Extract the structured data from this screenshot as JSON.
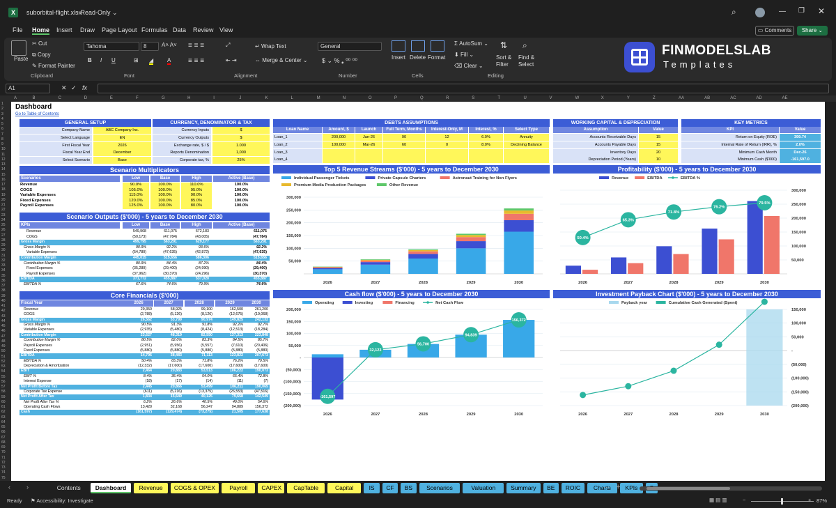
{
  "app": {
    "file_name": "suborbital-flight.xlsx",
    "mode": "Read-Only",
    "comments": "Comments",
    "share": "Share"
  },
  "menu": [
    "File",
    "Home",
    "Insert",
    "Draw",
    "Page Layout",
    "Formulas",
    "Data",
    "Review",
    "View"
  ],
  "ribbon": {
    "paste": "Paste",
    "cut": "Cut",
    "copy": "Copy",
    "format_painter": "Format Painter",
    "clipboard": "Clipboard",
    "font_name": "Tahoma",
    "font_size": "8",
    "font": "Font",
    "wrap": "Wrap Text",
    "merge": "Merge & Center",
    "alignment": "Alignment",
    "number_format": "General",
    "number": "Number",
    "insert": "Insert",
    "delete": "Delete",
    "format": "Format",
    "cells": "Cells",
    "autosum": "AutoSum",
    "fill": "Fill",
    "clear": "Clear",
    "sort": "Sort & Filter",
    "find": "Find & Select",
    "editing": "Editing",
    "brand": "FINMODELSLAB",
    "brand_sub": "Templates"
  },
  "formula_bar": {
    "cell_ref": "A1",
    "fx": "fx",
    "value": ""
  },
  "columns": [
    "A",
    "B",
    "C",
    "D",
    "E",
    "F",
    "G",
    "H",
    "I",
    "J",
    "K",
    "L",
    "M",
    "N",
    "O",
    "P",
    "Q",
    "R",
    "S",
    "T",
    "U",
    "V",
    "W",
    "X",
    "Y",
    "Z",
    "AA",
    "AB",
    "AC",
    "AD",
    "AE"
  ],
  "sheet": {
    "title": "Dashboard",
    "toc": "Go to Table of Contents",
    "general": {
      "title": "GENERAL SETUP",
      "rows": [
        [
          "Company Name",
          "ABC Company Inc."
        ],
        [
          "Select Language",
          "EN"
        ],
        [
          "First Fiscal Year",
          "2026"
        ],
        [
          "Fiscal Year End",
          "December"
        ],
        [
          "Select Scenario",
          "Base"
        ]
      ]
    },
    "currency": {
      "title": "CURRENCY, DENOMINATOR & TAX",
      "rows": [
        [
          "Currency Inputs",
          "$"
        ],
        [
          "Currency Outputs",
          "$"
        ],
        [
          "Exchange rate, $ / $",
          "1.000"
        ],
        [
          "Reports Denomination",
          "1,000"
        ],
        [
          "Corporate tax, %",
          "25%"
        ]
      ]
    },
    "debts": {
      "title": "DEBTS ASSUMPTIONS",
      "headers": [
        "Loan Name",
        "Amount, $",
        "Launch",
        "Full Term, Months",
        "Interest-Only, M",
        "Interest, %",
        "Select Type"
      ],
      "rows": [
        [
          "Loan_1",
          "200,000",
          "Jan-26",
          "90",
          "12",
          "6.0%",
          "Annuity"
        ],
        [
          "Loan_2",
          "100,000",
          "Mar-26",
          "60",
          "0",
          "8.0%",
          "Declining Balance"
        ],
        [
          "Loan_3",
          "",
          "",
          "",
          "",
          "",
          ""
        ],
        [
          "Loan_4",
          "",
          "",
          "",
          "",
          "",
          ""
        ]
      ]
    },
    "wc": {
      "title": "WORKING CAPITAL & DEPRECIATION",
      "headers": [
        "Assumption",
        "Value"
      ],
      "rows": [
        [
          "Accounts Receivable Days",
          "15"
        ],
        [
          "Accounts Payable Days",
          "15"
        ],
        [
          "Inventory Days",
          "20"
        ],
        [
          "Depreciation Period (Years)",
          "10"
        ]
      ]
    },
    "kpi": {
      "title": "KEY METRICS",
      "headers": [
        "KPI",
        "Value"
      ],
      "rows": [
        [
          "Return on Equity (ROE)",
          "399.74"
        ],
        [
          "Internal Rate of Return (IRR), %",
          "2.0%"
        ],
        [
          "Minimum Cash Month",
          "Dec-26"
        ],
        [
          "Minimum Cash ($'000)",
          "-161,597.0"
        ]
      ]
    },
    "multipliers": {
      "title": "Scenario Multiplicators",
      "headers": [
        "Scenarios",
        "Low",
        "Base",
        "High",
        "Active (Base)"
      ],
      "rows": [
        [
          "Revenue",
          "90.0%",
          "100.0%",
          "110.0%",
          "100.0%"
        ],
        [
          "COGS",
          "105.0%",
          "100.0%",
          "95.0%",
          "100.0%"
        ],
        [
          "Variable Expenses",
          "115.0%",
          "100.0%",
          "90.0%",
          "100.0%"
        ],
        [
          "Fixed Expenses",
          "120.0%",
          "100.0%",
          "85.0%",
          "100.0%"
        ],
        [
          "Payroll Expenses",
          "125.0%",
          "100.0%",
          "80.0%",
          "100.0%"
        ]
      ]
    },
    "outputs": {
      "title": "Scenario Outputs ($'000) - 5 years to December 2030",
      "headers": [
        "KPIs",
        "Low",
        "Base",
        "High",
        "Active (Base)"
      ],
      "rows": [
        [
          "Revenue",
          "549,968",
          "611,075",
          "672,183",
          "611,075",
          0
        ],
        [
          "COGS",
          "(50,173)",
          "(47,784)",
          "(43,005)",
          "(47,784)",
          0
        ],
        [
          "Gross Margin",
          "499,795",
          "563,291",
          "629,177",
          "563,291",
          1
        ],
        [
          "Gross Margin %",
          "90.9%",
          "92.2%",
          "93.6%",
          "92.2%",
          2
        ],
        [
          "Variable Expenses",
          "(54,780)",
          "(47,635)",
          "(42,872)",
          "(47,635)",
          0
        ],
        [
          "Contribution Margin",
          "445,015",
          "515,656",
          "586,306",
          "515,656",
          1
        ],
        [
          "Contribution Margin %",
          "80.9%",
          "84.4%",
          "87.2%",
          "84.4%",
          2
        ],
        [
          "Fixed Expenses",
          "(35,280)",
          "(29,400)",
          "(24,990)",
          "(29,400)",
          0
        ],
        [
          "Payroll Expenses",
          "(37,962)",
          "(30,370)",
          "(24,296)",
          "(30,370)",
          0
        ],
        [
          "EBITDA",
          "371,772",
          "455,887",
          "537,020",
          "455,887",
          1
        ],
        [
          "EBITDA %",
          "67.6%",
          "74.6%",
          "79.9%",
          "74.6%",
          2
        ]
      ]
    },
    "core": {
      "title": "Core Financials ($'000)",
      "headers": [
        "Fiscal Year",
        "2026",
        "2027",
        "2028",
        "2029",
        "2030"
      ],
      "rows": [
        [
          "Revenue",
          "29,350",
          "58,925",
          "99,100",
          "162,500",
          "261,200",
          0
        ],
        [
          "COGS",
          "(2,788)",
          "(5,126)",
          "(8,126)",
          "(12,675)",
          "(19,068)",
          0
        ],
        [
          "Gross Margin",
          "26,562",
          "53,799",
          "90,974",
          "149,825",
          "242,132",
          1
        ],
        [
          "Gross Margin %",
          "90.5%",
          "91.3%",
          "91.8%",
          "92.2%",
          "92.7%",
          2
        ],
        [
          "Variable Expenses",
          "(2,935)",
          "(5,480)",
          "(8,424)",
          "(12,513)",
          "(18,284)",
          0
        ],
        [
          "Contribution Margin",
          "23,627",
          "48,319",
          "82,550",
          "137,313",
          "223,848",
          1
        ],
        [
          "Contribution Margin %",
          "80.5%",
          "82.0%",
          "83.3%",
          "84.5%",
          "85.7%",
          2
        ],
        [
          "Payroll Expenses",
          "(2,951)",
          "(5,956)",
          "(5,557)",
          "(7,610)",
          "(20,406)",
          0
        ],
        [
          "Fixed Expenses",
          "(5,880)",
          "(5,880)",
          "(5,880)",
          "(5,880)",
          "(5,880)",
          0
        ],
        [
          "EBITDA",
          "14,796",
          "38,483",
          "71,113",
          "123,822",
          "207,673",
          1
        ],
        [
          "EBITDA %",
          "50.4%",
          "65.3%",
          "71.8%",
          "76.2%",
          "79.5%",
          2
        ],
        [
          "Depreciation & Amortization",
          "(12,332)",
          "(17,600)",
          "(17,600)",
          "(17,600)",
          "(17,600)",
          0
        ],
        [
          "EBIT",
          "2,464",
          "20,883",
          "53,513",
          "106,222",
          "190,073",
          1
        ],
        [
          "EBIT %",
          "8.4%",
          "35.4%",
          "54.0%",
          "65.4%",
          "72.8%",
          2
        ],
        [
          "Interest Expense",
          "(18)",
          "(17)",
          "(14)",
          "(11)",
          "(7)",
          0
        ],
        [
          "Net Profit Before Tax",
          "2,445",
          "20,866",
          "53,499",
          "106,211",
          "190,065",
          1
        ],
        [
          "Corporate Tax Expense",
          "(611)",
          "(5,216)",
          "(13,375)",
          "(26,553)",
          "(47,516)",
          0
        ],
        [
          "Net Profit After Tax",
          "1,834",
          "15,649",
          "40,125",
          "79,658",
          "142,549",
          1
        ],
        [
          "Net Profit After Tax %",
          "6.2%",
          "26.6%",
          "40.5%",
          "49.0%",
          "54.6%",
          2
        ],
        [
          "Operating Cash Flows",
          "13,420",
          "32,168",
          "56,247",
          "94,889",
          "156,372",
          0
        ],
        [
          "Cash",
          "(161,597)",
          "(129,474)",
          "(73,275)",
          "21,505",
          "177,638",
          1
        ]
      ]
    }
  },
  "chart_data": [
    {
      "id": "revenue_streams",
      "type": "bar",
      "stacked": true,
      "title": "Top 5 Revenue Streams ($'000) - 5 years to December 2030",
      "categories": [
        "2026",
        "2027",
        "2028",
        "2029",
        "2030"
      ],
      "ylim": [
        0,
        300000
      ],
      "yticks": [
        "300,000",
        "250,000",
        "200,000",
        "150,000",
        "100,000",
        "50,000"
      ],
      "series": [
        {
          "name": "Individual Passenger Tickets",
          "color": "#38a8e8",
          "values": [
            18000,
            36000,
            60000,
            100000,
            165000
          ]
        },
        {
          "name": "Private Capsule Charters",
          "color": "#3c4fd2",
          "values": [
            5000,
            10000,
            18000,
            28000,
            45000
          ]
        },
        {
          "name": "Astronaut Training for Non Flyers",
          "color": "#f0766a",
          "values": [
            3000,
            6000,
            10000,
            16000,
            25000
          ]
        },
        {
          "name": "Premium Media Production Packages",
          "color": "#e8b92d",
          "values": [
            1500,
            3000,
            5000,
            8000,
            13000
          ]
        },
        {
          "name": "Other Revenue",
          "color": "#5ec76a",
          "values": [
            1000,
            2000,
            3000,
            5000,
            8000
          ]
        }
      ]
    },
    {
      "id": "profitability",
      "type": "bar+line",
      "title": "Profitability ($'000) - 5 years to December 2030",
      "categories": [
        "2026",
        "2027",
        "2028",
        "2029",
        "2030"
      ],
      "ylim": [
        0,
        300000
      ],
      "yticks": [
        "300,000",
        "250,000",
        "200,000",
        "150,000",
        "100,000",
        "50,000"
      ],
      "series": [
        {
          "name": "Revenue",
          "color": "#3c4fd2",
          "values": [
            29350,
            58925,
            99100,
            162500,
            261200
          ]
        },
        {
          "name": "EBITDA",
          "color": "#f0766a",
          "values": [
            14796,
            38483,
            71113,
            123822,
            207673
          ]
        },
        {
          "name": "EBITDA %",
          "color": "#2bb5a0",
          "values": [
            50.4,
            65.3,
            71.8,
            76.2,
            79.5
          ],
          "labels": [
            "50.4%",
            "65.3%",
            "71.8%",
            "76.2%",
            "79.5%"
          ]
        }
      ]
    },
    {
      "id": "cash_flow",
      "type": "bar+line",
      "title": "Cash flow ($'000) - 5 years to December 2030",
      "categories": [
        "2026",
        "2027",
        "2028",
        "2029",
        "2030"
      ],
      "ylim": [
        -200000,
        200000
      ],
      "yticks": [
        "200,000",
        "150,000",
        "100,000",
        "50,000",
        "-",
        "(50,000)",
        "(100,000)",
        "(150,000)",
        "(200,000)"
      ],
      "series": [
        {
          "name": "Operating",
          "color": "#38a8e8",
          "values": [
            13420,
            32168,
            56247,
            94889,
            156372
          ]
        },
        {
          "name": "Investing",
          "color": "#3c4fd2",
          "values": [
            -175017,
            0,
            0,
            0,
            0
          ]
        },
        {
          "name": "Financing",
          "color": "#f0766a",
          "values": [
            0,
            0,
            0,
            0,
            0
          ]
        },
        {
          "name": "Net Cash Flow",
          "color": "#2bb5a0",
          "values": [
            -161597,
            32123,
            56700,
            94839,
            156372
          ],
          "labels": [
            "-161,597",
            "32,123",
            "56,700",
            "94,839",
            "156,372"
          ]
        }
      ]
    },
    {
      "id": "payback",
      "type": "bar+line",
      "title": "Investment Payback Chart ($'000) - 5 years to December 2030",
      "categories": [
        "2026",
        "2027",
        "2028",
        "2029",
        "2030"
      ],
      "ylim": [
        -200000,
        150000
      ],
      "yticks": [
        "150,000",
        "100,000",
        "50,000",
        "-",
        "(50,000)",
        "(100,000)",
        "(150,000)",
        "(200,000)"
      ],
      "series": [
        {
          "name": "Payback year",
          "color": "#a8d8ee",
          "values": [
            0,
            0,
            0,
            0,
            1
          ]
        },
        {
          "name": "Cumulative Cash Generated (Spent)",
          "color": "#2bb5a0",
          "values": [
            -161597,
            -129474,
            -73275,
            21505,
            177638
          ]
        }
      ]
    }
  ],
  "tabs": [
    "Contents",
    "Dashboard",
    "Revenue",
    "COGS & OPEX",
    "Payroll",
    "CAPEX",
    "CapTable",
    "Capital",
    "IS",
    "CF",
    "BS",
    "Scenarios",
    "Valuation",
    "Summary",
    "BE",
    "ROIC",
    "Charts",
    "KPIs",
    "S"
  ],
  "status": {
    "ready": "Ready",
    "accessibility": "Accessibility: Investigate",
    "zoom": "87%"
  }
}
